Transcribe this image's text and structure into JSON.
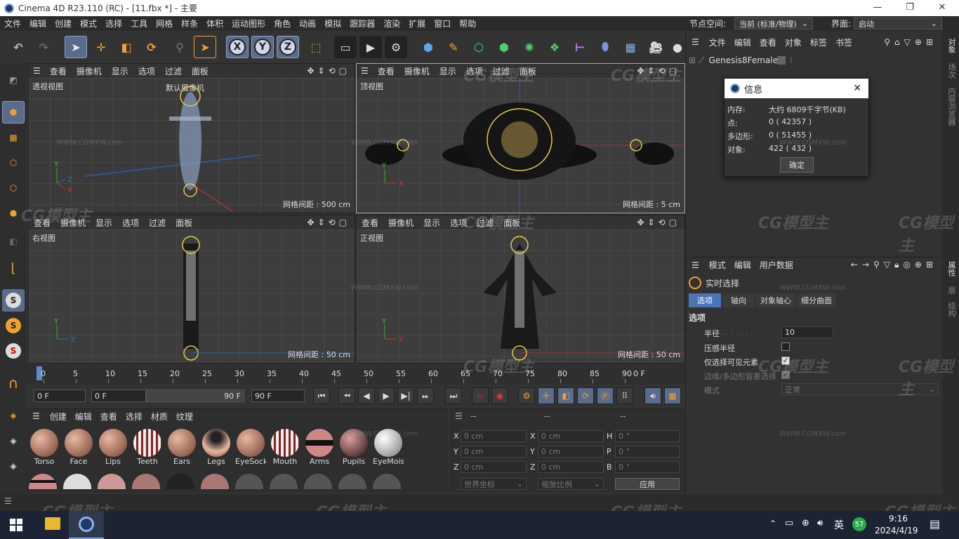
{
  "window": {
    "title": "Cinema 4D R23.110 (RC) - [11.fbx *] - 主要",
    "min_icon": "—",
    "max_icon": "❐",
    "close_icon": "✕"
  },
  "menu": [
    "文件",
    "编辑",
    "创建",
    "模式",
    "选择",
    "工具",
    "网格",
    "样条",
    "体积",
    "运动图形",
    "角色",
    "动画",
    "模拟",
    "跟踪器",
    "渲染",
    "扩展",
    "窗口",
    "帮助"
  ],
  "node_space": {
    "label": "节点空间:",
    "value": "当前 (标准/物理)"
  },
  "layout": {
    "label": "界面:",
    "value": "启动"
  },
  "toolbar": {
    "x_label": "X",
    "y_label": "Y",
    "z_label": "Z"
  },
  "viewports": [
    {
      "name": "透视视图",
      "camera": "默认摄像机",
      "grid": "网格间距 : 500 cm",
      "menu": [
        "查看",
        "摄像机",
        "显示",
        "选项",
        "过滤",
        "面板"
      ]
    },
    {
      "name": "顶视图",
      "grid": "网格间距 : 5 cm",
      "menu": [
        "查看",
        "摄像机",
        "显示",
        "选项",
        "过滤",
        "面板"
      ]
    },
    {
      "name": "右视图",
      "grid": "网格间距 : 50 cm",
      "menu": [
        "查看",
        "摄像机",
        "显示",
        "选项",
        "过滤",
        "面板"
      ]
    },
    {
      "name": "正视图",
      "grid": "网格间距 : 50 cm",
      "menu": [
        "查看",
        "摄像机",
        "显示",
        "选项",
        "过滤",
        "面板"
      ]
    }
  ],
  "axis_labels": {
    "x": "X",
    "y": "Y",
    "z": "Z"
  },
  "timeline": {
    "ticks": [
      "0",
      "5",
      "10",
      "15",
      "20",
      "25",
      "30",
      "35",
      "40",
      "45",
      "50",
      "55",
      "60",
      "65",
      "70",
      "75",
      "80",
      "85",
      "90"
    ],
    "end_label": "0 F",
    "current_frame": "0 F",
    "range_start": "0 F",
    "range_end": "90 F",
    "max_frame": "90 F"
  },
  "object_manager": {
    "menu": [
      "文件",
      "编辑",
      "查看",
      "对象",
      "标签",
      "书签"
    ],
    "object": "Genesis8Female"
  },
  "info_dialog": {
    "title": "信息",
    "rows": [
      {
        "label": "内存:",
        "value": "大约 6809千字节(KB)"
      },
      {
        "label": "点:",
        "value": "0 ( 42357 )"
      },
      {
        "label": "多边形:",
        "value": "0 ( 51455 )"
      },
      {
        "label": "对象:",
        "value": "422 ( 432 )"
      }
    ],
    "ok": "确定"
  },
  "attributes": {
    "menu": [
      "模式",
      "编辑",
      "用户数据"
    ],
    "tool": "实时选择",
    "tabs": [
      "选项",
      "轴向",
      "对象轴心",
      "细分曲面"
    ],
    "section": "选项",
    "radius_label": "半径",
    "radius_value": "10",
    "pressure_label": "压感半径",
    "visible_only_label": "仅选择可见元素",
    "edge_label": "边缘/多边形容差选择",
    "mode_label": "模式",
    "mode_value": "正常"
  },
  "materials": {
    "menu": [
      "创建",
      "编辑",
      "查看",
      "选择",
      "材质",
      "纹理"
    ],
    "items": [
      "Torso",
      "Face",
      "Lips",
      "Teeth",
      "Ears",
      "Legs",
      "EyeSock",
      "Mouth",
      "Arms",
      "Pupils",
      "EyeMois"
    ]
  },
  "coords": {
    "headers": [
      "--",
      "--",
      "--"
    ],
    "rows": [
      {
        "a": "X",
        "av": "0 cm",
        "b": "X",
        "bv": "0 cm",
        "c": "H",
        "cv": "0 °"
      },
      {
        "a": "Y",
        "av": "0 cm",
        "b": "Y",
        "bv": "0 cm",
        "c": "P",
        "cv": "0 °"
      },
      {
        "a": "Z",
        "av": "0 cm",
        "b": "Z",
        "bv": "0 cm",
        "c": "B",
        "cv": "0 °"
      }
    ],
    "world": "世界坐标",
    "scale": "缩放比例",
    "apply": "应用"
  },
  "side_tabs": [
    "对象",
    "场次",
    "内容浏览器",
    "属性",
    "层",
    "结构"
  ],
  "watermark": {
    "text": "CG模型主",
    "url": "WWW.CGMXW.com"
  },
  "taskbar": {
    "time": "9:16",
    "date": "2024/4/19",
    "ime": "英",
    "badge": "57"
  },
  "colors": {
    "accent": "#4d74b8",
    "selected_tab": "#4d74b8",
    "ui_bg": "#333333"
  }
}
